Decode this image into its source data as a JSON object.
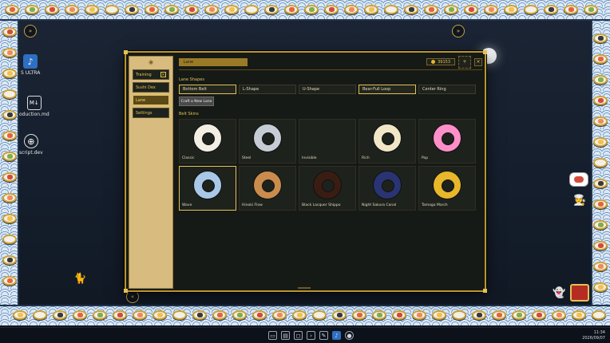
{
  "desktop": {
    "icons": [
      {
        "label": "S ULTRA",
        "icon": "app-icon"
      },
      {
        "label": "oduction.md",
        "icon": "markdown-icon",
        "glyph": "M↓"
      },
      {
        "label": "script.dev",
        "icon": "globe-icon"
      }
    ]
  },
  "window": {
    "sidebar": {
      "items": [
        {
          "label": "Training",
          "has_close": true
        },
        {
          "label": "Sushi Dex"
        },
        {
          "label": "Lane"
        },
        {
          "label": "Settings"
        }
      ],
      "active_index": 2
    },
    "title": "Lane",
    "points": "39153",
    "add_label": "+",
    "close_label": "×",
    "lane_shapes_label": "Lane Shapes",
    "shapes": [
      "Bottom Belt",
      "L-Shape",
      "U-Shape",
      "Bear-Full Loop",
      "Center Ring"
    ],
    "selected_shape_indices": [
      0,
      3
    ],
    "craft_label": "Craft a New Lane",
    "belt_skins_label": "Belt Skins",
    "skins": [
      {
        "name": "Classic",
        "color": "#f2eee4"
      },
      {
        "name": "Steel",
        "color": "#c6ccd4"
      },
      {
        "name": "Invisible",
        "color": ""
      },
      {
        "name": "Rich",
        "color": "#f1e7c6"
      },
      {
        "name": "Pop",
        "color": "#ff8fc8"
      },
      {
        "name": "Wave",
        "color": "#a9c8e8"
      },
      {
        "name": "Hinoki Flow",
        "color": "#c98c4d"
      },
      {
        "name": "Black Lacquer Shippo",
        "color": "#3a1d12"
      },
      {
        "name": "Night Sakura Canal",
        "color": "#2a3472"
      },
      {
        "name": "Tamago March",
        "color": "#e8b72a"
      }
    ],
    "selected_skin_index": 5
  },
  "taskbar": {
    "time": "11:34",
    "date": "2026/09/07"
  },
  "colors": {
    "accent": "#e3c154",
    "sidebar_bg": "#d8bb7f"
  }
}
